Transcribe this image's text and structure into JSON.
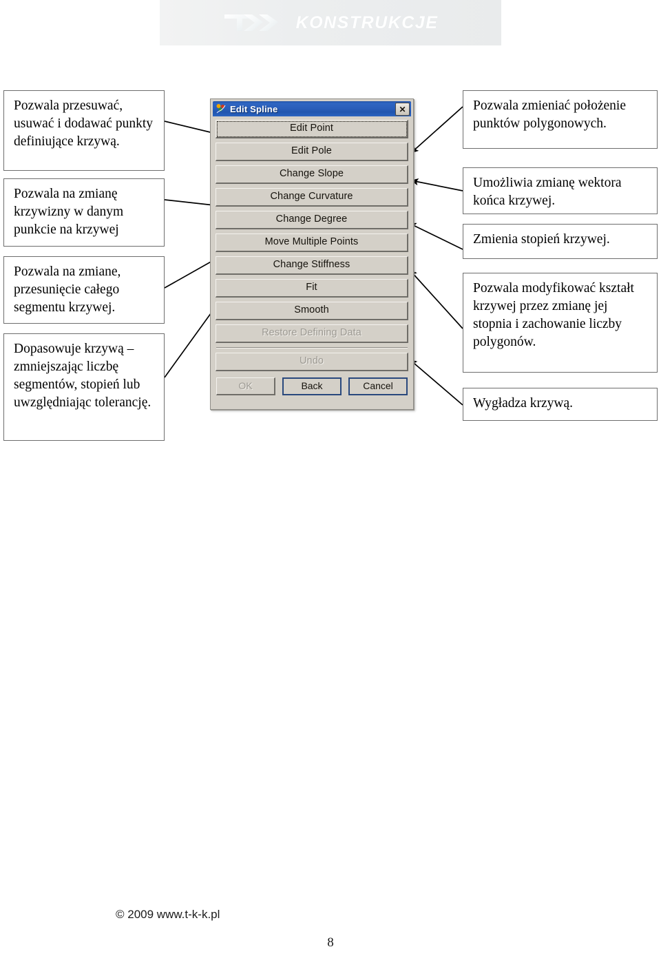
{
  "header": {
    "logo_mark": "tkk-logo-mark",
    "logo_text": "KONSTRUKCJE"
  },
  "left_callouts": [
    {
      "id": "callout-edit-point",
      "text": "Pozwala przesuwać, usuwać i dodawać punkty definiujące krzywą."
    },
    {
      "id": "callout-change-curvature",
      "text": "Pozwala na zmianę krzywizny w danym punkcie na krzywej"
    },
    {
      "id": "callout-move-multiple-points",
      "text": "Pozwala na zmiane, przesunięcie całego segmentu krzywej."
    },
    {
      "id": "callout-fit",
      "text": "Dopasowuje krzywą – zmniejszając liczbę segmentów, stopień lub uwzględniając tolerancję."
    }
  ],
  "right_callouts": [
    {
      "id": "callout-edit-pole",
      "text": "Pozwala zmieniać położenie punktów polygonowych."
    },
    {
      "id": "callout-change-slope",
      "text": "Umożliwia zmianę wektora końca krzywej."
    },
    {
      "id": "callout-change-degree",
      "text": "Zmienia stopień krzywej."
    },
    {
      "id": "callout-change-stiffness",
      "text": "Pozwala modyfikować kształt krzywej przez zmianę jej stopnia i zachowanie liczby polygonów."
    },
    {
      "id": "callout-smooth",
      "text": "Wygładza krzywą."
    }
  ],
  "dialog": {
    "title": "Edit Spline",
    "icon": "edit-spline-icon",
    "close_label": "✕",
    "buttons": [
      {
        "label": "Edit Point",
        "state": "focused"
      },
      {
        "label": "Edit Pole",
        "state": "normal"
      },
      {
        "label": "Change Slope",
        "state": "normal"
      },
      {
        "label": "Change Curvature",
        "state": "normal"
      },
      {
        "label": "Change Degree",
        "state": "normal"
      },
      {
        "label": "Move Multiple Points",
        "state": "normal"
      },
      {
        "label": "Change Stiffness",
        "state": "normal"
      },
      {
        "label": "Fit",
        "state": "normal"
      },
      {
        "label": "Smooth",
        "state": "normal"
      },
      {
        "label": "Restore Defining Data",
        "state": "disabled"
      }
    ],
    "undo_button": {
      "label": "Undo",
      "state": "disabled"
    },
    "footer_buttons": [
      {
        "label": "OK",
        "state": "disabled"
      },
      {
        "label": "Back",
        "state": "default"
      },
      {
        "label": "Cancel",
        "state": "default"
      }
    ]
  },
  "footer": {
    "copyright": "© 2009 www.t-k-k.pl",
    "page_number": "8"
  },
  "colors": {
    "dialog_face": "#d4d0c8",
    "titlebar_blue": "#2a5fbb",
    "box_border": "#6d6d6d",
    "header_band": "#edeff0"
  }
}
